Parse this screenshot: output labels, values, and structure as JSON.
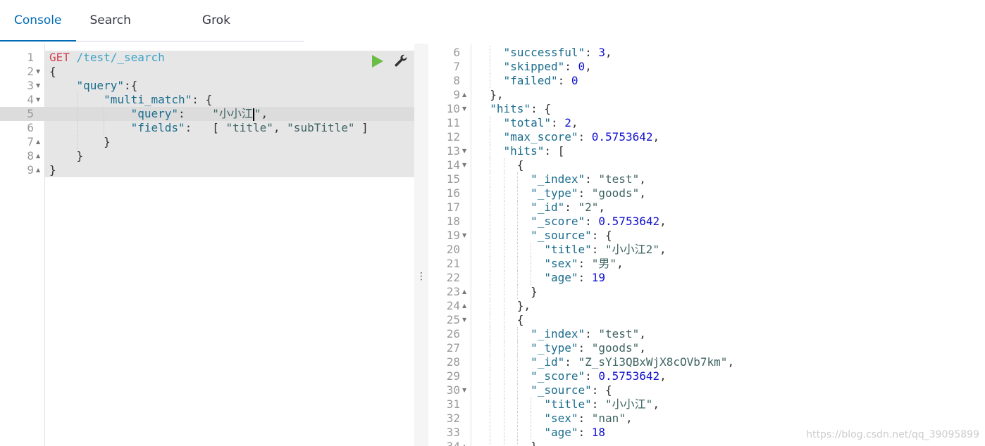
{
  "tabs": [
    {
      "label": "Console",
      "active": true
    },
    {
      "label": "Search Profiler",
      "active": false
    },
    {
      "label": "Grok Debugger",
      "active": false
    }
  ],
  "request": {
    "method": "GET",
    "path": "/test/_search",
    "lines": [
      {
        "n": "1",
        "fold": "",
        "text": ""
      },
      {
        "n": "2",
        "fold": "open",
        "text": "{"
      },
      {
        "n": "3",
        "fold": "open",
        "text": "    \"query\":{"
      },
      {
        "n": "4",
        "fold": "open",
        "text": "        \"multi_match\": {"
      },
      {
        "n": "5",
        "fold": "",
        "text": "            \"query\":    \"小小江|\","
      },
      {
        "n": "6",
        "fold": "",
        "text": "            \"fields\":   [ \"title\", \"subTitle\" ]"
      },
      {
        "n": "7",
        "fold": "close",
        "text": "        }"
      },
      {
        "n": "8",
        "fold": "close",
        "text": "    }"
      },
      {
        "n": "9",
        "fold": "close",
        "text": "}"
      }
    ],
    "run_icon": "play-icon",
    "settings_icon": "wrench-icon"
  },
  "divider_icon": "vertical-ellipsis-icon",
  "response": {
    "lines": [
      {
        "n": "6",
        "fold": "",
        "text": "    \"successful\": 3,"
      },
      {
        "n": "7",
        "fold": "",
        "text": "    \"skipped\": 0,"
      },
      {
        "n": "8",
        "fold": "",
        "text": "    \"failed\": 0"
      },
      {
        "n": "9",
        "fold": "close",
        "text": "  },"
      },
      {
        "n": "10",
        "fold": "open",
        "text": "  \"hits\": {"
      },
      {
        "n": "11",
        "fold": "",
        "text": "    \"total\": 2,"
      },
      {
        "n": "12",
        "fold": "",
        "text": "    \"max_score\": 0.5753642,"
      },
      {
        "n": "13",
        "fold": "open",
        "text": "    \"hits\": ["
      },
      {
        "n": "14",
        "fold": "open",
        "text": "      {"
      },
      {
        "n": "15",
        "fold": "",
        "text": "        \"_index\": \"test\","
      },
      {
        "n": "16",
        "fold": "",
        "text": "        \"_type\": \"goods\","
      },
      {
        "n": "17",
        "fold": "",
        "text": "        \"_id\": \"2\","
      },
      {
        "n": "18",
        "fold": "",
        "text": "        \"_score\": 0.5753642,"
      },
      {
        "n": "19",
        "fold": "open",
        "text": "        \"_source\": {"
      },
      {
        "n": "20",
        "fold": "",
        "text": "          \"title\": \"小小江2\","
      },
      {
        "n": "21",
        "fold": "",
        "text": "          \"sex\": \"男\","
      },
      {
        "n": "22",
        "fold": "",
        "text": "          \"age\": 19"
      },
      {
        "n": "23",
        "fold": "close",
        "text": "        }"
      },
      {
        "n": "24",
        "fold": "close",
        "text": "      },"
      },
      {
        "n": "25",
        "fold": "open",
        "text": "      {"
      },
      {
        "n": "26",
        "fold": "",
        "text": "        \"_index\": \"test\","
      },
      {
        "n": "27",
        "fold": "",
        "text": "        \"_type\": \"goods\","
      },
      {
        "n": "28",
        "fold": "",
        "text": "        \"_id\": \"Z_sYi3QBxWjX8cOVb7km\","
      },
      {
        "n": "29",
        "fold": "",
        "text": "        \"_score\": 0.5753642,"
      },
      {
        "n": "30",
        "fold": "open",
        "text": "        \"_source\": {"
      },
      {
        "n": "31",
        "fold": "",
        "text": "          \"title\": \"小小江\","
      },
      {
        "n": "32",
        "fold": "",
        "text": "          \"sex\": \"nan\","
      },
      {
        "n": "33",
        "fold": "",
        "text": "          \"age\": 18"
      },
      {
        "n": "34",
        "fold": "close",
        "text": "        }"
      }
    ]
  },
  "watermark": "https://blog.csdn.net/qq_39095899"
}
